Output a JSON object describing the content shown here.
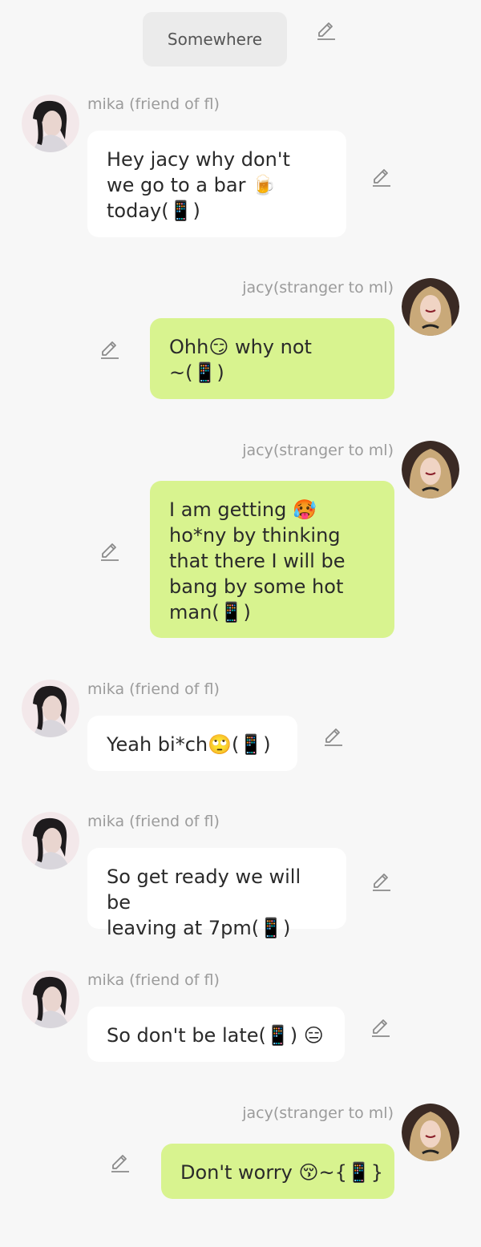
{
  "location": {
    "label": "Somewhere"
  },
  "participants": {
    "mika": {
      "display_name": "mika (friend of fl)"
    },
    "jacy": {
      "display_name": "jacy(stranger to ml)"
    }
  },
  "messages": [
    {
      "sender": "mika",
      "side": "left",
      "text": "Hey jacy why don't\nwe go to a bar 🍺\ntoday(📱)"
    },
    {
      "sender": "jacy",
      "side": "right",
      "text": "Ohh😏 why not\n~(📱)"
    },
    {
      "sender": "jacy",
      "side": "right",
      "text": "I am getting 🥵\nho*ny by thinking\nthat there I will be\nbang by some hot\nman(📱)"
    },
    {
      "sender": "mika",
      "side": "left",
      "text": "Yeah bi*ch🙄(📱)"
    },
    {
      "sender": "mika",
      "side": "left",
      "text": "So get ready we will be\nleaving at 7pm(📱)"
    },
    {
      "sender": "mika",
      "side": "left",
      "text": "So don't be late(📱) 😑"
    },
    {
      "sender": "jacy",
      "side": "right",
      "text": "Don't worry 😚~{📱}"
    }
  ]
}
